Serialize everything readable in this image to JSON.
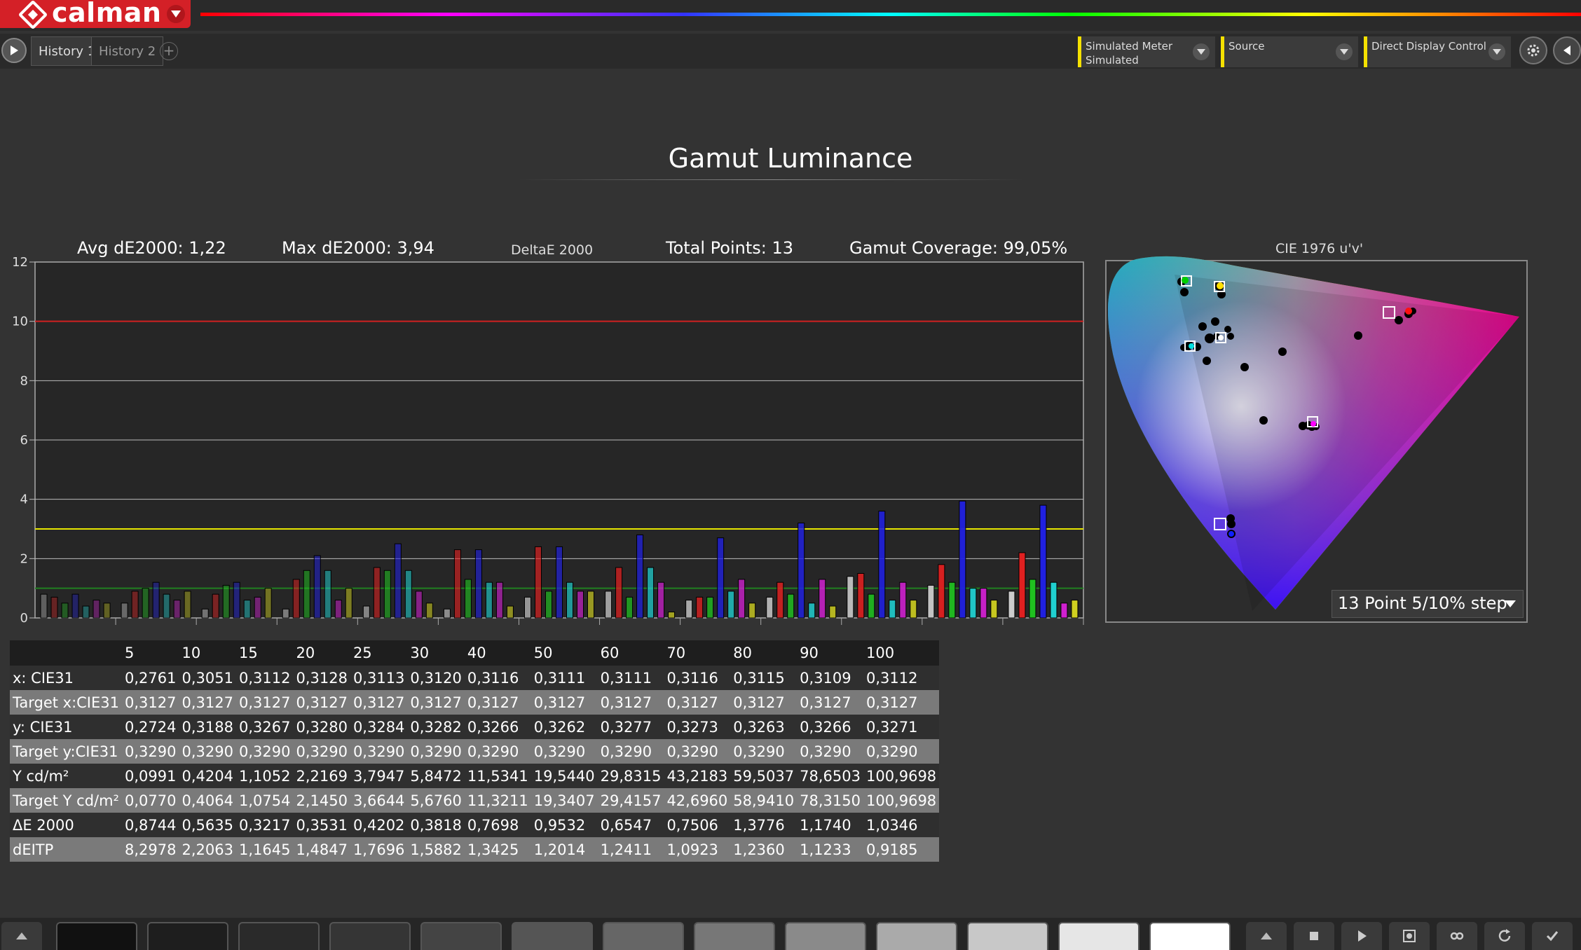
{
  "app": {
    "logo_text": "calman"
  },
  "tabs": [
    "History 1",
    "History 2"
  ],
  "tab_add": "+",
  "dropdowns": [
    {
      "line1": "Simulated Meter",
      "line2": "Simulated"
    },
    {
      "line1": "Source",
      "line2": ""
    },
    {
      "line1": "Direct Display Control",
      "line2": ""
    }
  ],
  "page_title": "Gamut Luminance",
  "stats": {
    "avg": "Avg dE2000: 1,22",
    "max": "Max dE2000: 3,94",
    "metric": "DeltaE 2000",
    "total": "Total Points: 13",
    "coverage": "Gamut Coverage: 99,05%"
  },
  "chart_data": {
    "type": "bar",
    "categories": [
      "5",
      "10",
      "15",
      "20",
      "25",
      "30",
      "40",
      "50",
      "60",
      "70",
      "80",
      "90",
      "100"
    ],
    "ylim": [
      0,
      12
    ],
    "yticks": [
      "0",
      "2",
      "4",
      "6",
      "8",
      "10",
      "12"
    ],
    "threshold_lines": [
      {
        "value": 10,
        "color": "#d02020"
      },
      {
        "value": 3,
        "color": "#e6e600"
      },
      {
        "value": 1,
        "color": "#208020"
      }
    ],
    "series": [
      {
        "color": "#cccccc",
        "values": [
          0.8,
          0.5,
          0.3,
          0.3,
          0.4,
          0.3,
          0.7,
          0.9,
          0.6,
          0.7,
          1.4,
          1.1,
          0.9
        ]
      },
      {
        "color": "#e02020",
        "values": [
          0.7,
          0.9,
          0.8,
          1.3,
          1.7,
          2.3,
          2.4,
          1.7,
          0.7,
          1.2,
          1.5,
          1.8,
          2.2
        ]
      },
      {
        "color": "#20c020",
        "values": [
          0.5,
          1.0,
          1.1,
          1.6,
          1.6,
          1.3,
          0.9,
          0.7,
          0.7,
          0.8,
          0.8,
          1.2,
          1.3
        ]
      },
      {
        "color": "#2020e0",
        "values": [
          0.8,
          1.2,
          1.2,
          2.1,
          2.5,
          2.3,
          2.4,
          2.8,
          2.7,
          3.2,
          3.6,
          3.94,
          3.8
        ]
      },
      {
        "color": "#20d0d0",
        "values": [
          0.4,
          0.8,
          0.6,
          1.6,
          1.6,
          1.2,
          1.2,
          1.7,
          0.9,
          0.5,
          0.6,
          1.0,
          1.2
        ]
      },
      {
        "color": "#d020d0",
        "values": [
          0.6,
          0.6,
          0.7,
          0.6,
          0.9,
          1.2,
          0.9,
          1.2,
          1.3,
          1.3,
          1.2,
          1.0,
          0.5
        ]
      },
      {
        "color": "#d0d020",
        "values": [
          0.5,
          0.9,
          1.0,
          1.0,
          0.5,
          0.4,
          0.9,
          0.2,
          0.5,
          0.4,
          0.6,
          0.6,
          0.6
        ]
      }
    ]
  },
  "cie": {
    "title": "CIE 1976 u'v'",
    "select_value": "13 Point 5/10% step"
  },
  "table": {
    "headers": [
      "5",
      "10",
      "15",
      "20",
      "25",
      "30",
      "40",
      "50",
      "60",
      "70",
      "80",
      "90",
      "100"
    ],
    "rows": [
      {
        "label": "x: CIE31",
        "values": [
          "0,2761",
          "0,3051",
          "0,3112",
          "0,3128",
          "0,3113",
          "0,3120",
          "0,3116",
          "0,3111",
          "0,3111",
          "0,3116",
          "0,3115",
          "0,3109",
          "0,3112"
        ]
      },
      {
        "label": "Target x:CIE31",
        "values": [
          "0,3127",
          "0,3127",
          "0,3127",
          "0,3127",
          "0,3127",
          "0,3127",
          "0,3127",
          "0,3127",
          "0,3127",
          "0,3127",
          "0,3127",
          "0,3127",
          "0,3127"
        ]
      },
      {
        "label": "y: CIE31",
        "values": [
          "0,2724",
          "0,3188",
          "0,3267",
          "0,3280",
          "0,3284",
          "0,3282",
          "0,3266",
          "0,3262",
          "0,3277",
          "0,3273",
          "0,3263",
          "0,3266",
          "0,3271"
        ]
      },
      {
        "label": "Target y:CIE31",
        "values": [
          "0,3290",
          "0,3290",
          "0,3290",
          "0,3290",
          "0,3290",
          "0,3290",
          "0,3290",
          "0,3290",
          "0,3290",
          "0,3290",
          "0,3290",
          "0,3290",
          "0,3290"
        ]
      },
      {
        "label": "Y cd/m²",
        "values": [
          "0,0991",
          "0,4204",
          "1,1052",
          "2,2169",
          "3,7947",
          "5,8472",
          "11,5341",
          "19,5440",
          "29,8315",
          "43,2183",
          "59,5037",
          "78,6503",
          "100,9698"
        ]
      },
      {
        "label": "Target Y cd/m²",
        "values": [
          "0,0770",
          "0,4064",
          "1,0754",
          "2,1450",
          "3,6644",
          "5,6760",
          "11,3211",
          "19,3407",
          "29,4157",
          "42,6960",
          "58,9410",
          "78,3150",
          "100,9698"
        ]
      },
      {
        "label": "ΔE 2000",
        "values": [
          "0,8744",
          "0,5635",
          "0,3217",
          "0,3531",
          "0,4202",
          "0,3818",
          "0,7698",
          "0,9532",
          "0,6547",
          "0,7506",
          "1,3776",
          "1,1740",
          "1,0346"
        ]
      },
      {
        "label": "dEITP",
        "values": [
          "8,2978",
          "2,2063",
          "1,1645",
          "1,4847",
          "1,7696",
          "1,5882",
          "1,3425",
          "1,2014",
          "1,2411",
          "1,0923",
          "1,2360",
          "1,1233",
          "0,9185"
        ]
      }
    ]
  },
  "bottom_swatches": [
    "#111111",
    "#1e1e1e",
    "#2a2a2a",
    "#353535",
    "#444444",
    "#555555",
    "#666666",
    "#777777",
    "#8a8a8a",
    "#aaaaaa",
    "#c8c8c8",
    "#e6e6e6",
    "#ffffff"
  ],
  "bottom_icons": [
    "stop-icon",
    "play-icon",
    "record-icon",
    "loop-icon",
    "refresh-icon",
    "check-icon"
  ]
}
